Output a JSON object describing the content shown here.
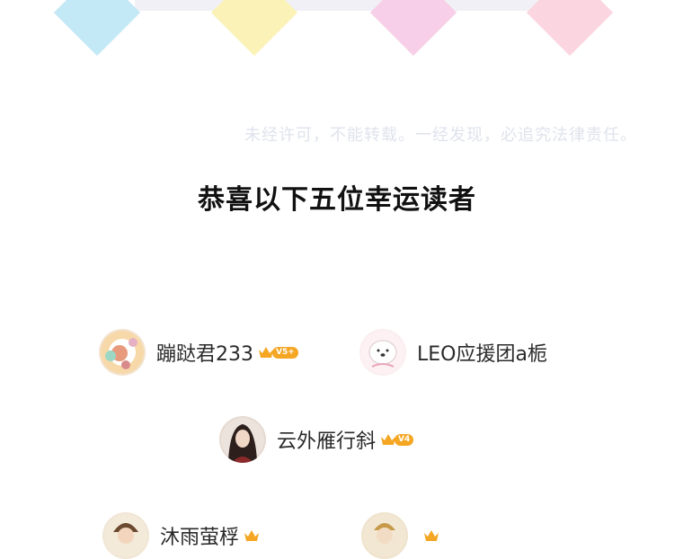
{
  "watermark": "未经许可，不能转载。一经发现，必追究法律责任。",
  "headline": "恭喜以下五位幸运读者",
  "decor": {
    "diamond_colors": [
      "#c3e8f6",
      "#fbf2b8",
      "#f8cfe8",
      "#fbd5e0"
    ],
    "faint_bar_color": "#f1f0f6"
  },
  "readers": [
    {
      "name": "蹦跶君233",
      "vip": "V5+"
    },
    {
      "name": "LEO应援团a栀",
      "vip": ""
    },
    {
      "name": "云外雁行斜",
      "vip": "V4"
    },
    {
      "name": "沐雨萤桴",
      "vip": ""
    },
    {
      "name": "",
      "vip": ""
    }
  ]
}
